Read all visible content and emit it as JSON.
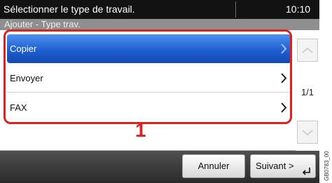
{
  "header": {
    "title": "Sélectionner le type de travail.",
    "time": "10:10"
  },
  "subheader": {
    "text": "Ajouter - Type trav."
  },
  "job_types": [
    {
      "label": "Copier",
      "selected": true
    },
    {
      "label": "Envoyer",
      "selected": false
    },
    {
      "label": "FAX",
      "selected": false
    }
  ],
  "pagination": {
    "indicator": "1/1"
  },
  "annotation": {
    "callout": "1",
    "color": "#e02020"
  },
  "footer": {
    "cancel_label": "Annuler",
    "next_label": "Suivant >"
  },
  "figure_code": "GB0783_00",
  "colors": {
    "selected_row": "#1f5fd2",
    "header": "#121212",
    "subheader": "#8f8f8f"
  }
}
